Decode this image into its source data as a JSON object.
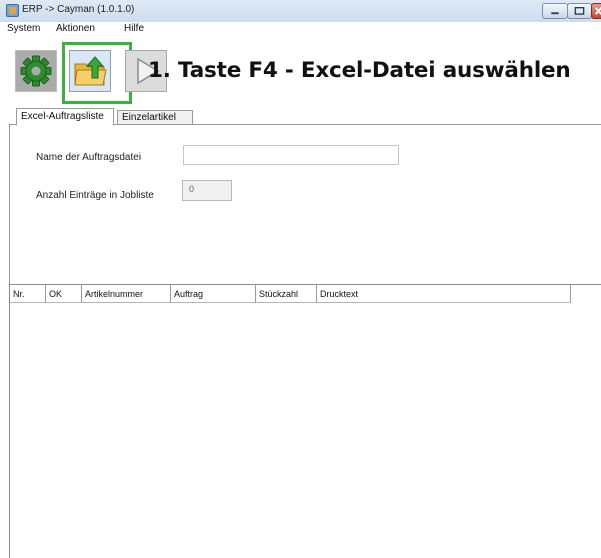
{
  "window": {
    "title": "ERP -> Cayman (1.0.1.0)",
    "controls": [
      "minimize",
      "maximize",
      "close"
    ]
  },
  "menu": {
    "items": [
      "System",
      "Aktionen",
      "Hilfe"
    ]
  },
  "toolbar": {
    "buttons": [
      {
        "icon": "gear-icon",
        "accent": "#2e8b2e"
      },
      {
        "icon": "folder-upload-icon",
        "accent": "#3aa83a"
      },
      {
        "icon": "play-icon",
        "accent": "#8c8c8c"
      }
    ],
    "highlight_color": "#3cb043"
  },
  "annotation": {
    "text": "1. Taste F4 - Excel-Datei auswählen"
  },
  "tabs": [
    {
      "label": "Excel-Auftragsliste",
      "active": true
    },
    {
      "label": "Einzelartikel",
      "active": false
    }
  ],
  "form": {
    "filename_label": "Name der Auftragsdatei",
    "filename_value": "",
    "count_label": "Anzahl Einträge in Jobliste",
    "count_value": "0"
  },
  "list": {
    "columns": [
      "Nr.",
      "OK",
      "Artikelnummer",
      "Auftrag",
      "Stückzahl",
      "Drucktext"
    ],
    "rows": []
  }
}
